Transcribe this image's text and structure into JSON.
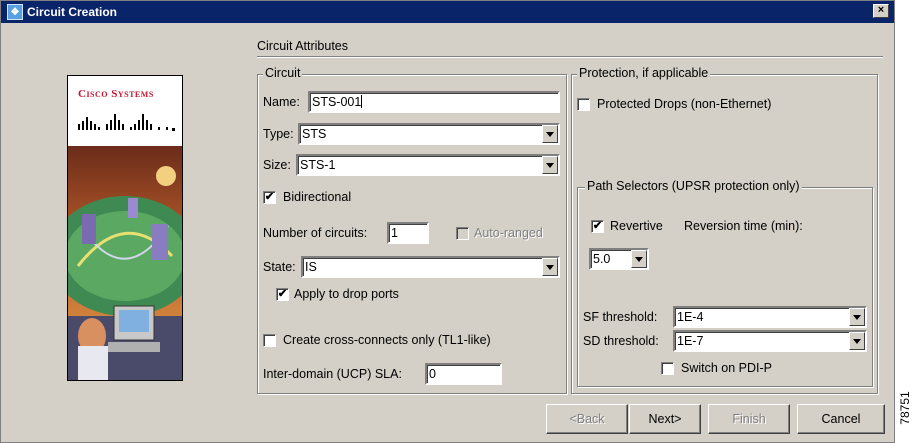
{
  "window": {
    "title": "Circuit Creation",
    "close_glyph": "×"
  },
  "logo": {
    "brand": "Cisco Systems"
  },
  "section": {
    "title": "Circuit Attributes"
  },
  "circuit": {
    "group_title": "Circuit",
    "name_label": "Name:",
    "name_value": "STS-001",
    "type_label": "Type:",
    "type_value": "STS",
    "size_label": "Size:",
    "size_value": "STS-1",
    "bidirectional_label": "Bidirectional",
    "bidirectional_checked": true,
    "num_circuits_label": "Number of circuits:",
    "num_circuits_value": "1",
    "auto_ranged_label": "Auto-ranged",
    "state_label": "State:",
    "state_value": "IS",
    "apply_drop_label": "Apply to drop ports",
    "apply_drop_checked": true,
    "cross_connects_label": "Create cross-connects only (TL1-like)",
    "cross_connects_checked": false,
    "sla_label": "Inter-domain (UCP) SLA:",
    "sla_value": "0"
  },
  "protection": {
    "group_title": "Protection, if applicable",
    "protected_drops_label": "Protected Drops (non-Ethernet)",
    "protected_drops_checked": false,
    "path_selectors": {
      "group_title": "Path Selectors (UPSR protection only)",
      "revertive_label": "Revertive",
      "revertive_checked": true,
      "reversion_time_label": "Reversion time (min):",
      "reversion_time_value": "5.0",
      "sf_label": "SF threshold:",
      "sf_value": "1E-4",
      "sd_label": "SD threshold:",
      "sd_value": "1E-7",
      "switch_pdi_label": "Switch on PDI-P",
      "switch_pdi_checked": false
    }
  },
  "buttons": {
    "back": "<Back",
    "next": "Next>",
    "finish": "Finish",
    "cancel": "Cancel"
  },
  "side_number": "78751",
  "check_glyph": "✔",
  "colors": {
    "titlebar": "#0a246a",
    "dialog_bg": "#d4d0c8",
    "logo_red": "#c8102e"
  }
}
